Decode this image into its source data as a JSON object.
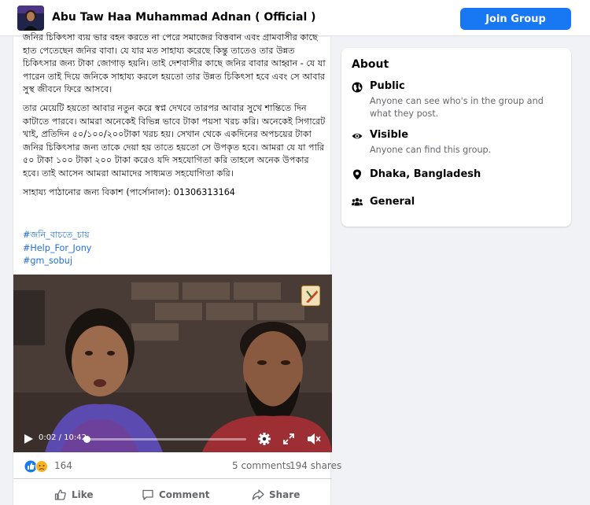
{
  "header": {
    "group_name": "Abu Taw Haa Muhammad Adnan ( Official )",
    "join_label": "Join Group"
  },
  "post": {
    "paragraph1": "জনির চিকিৎসা ব্যয় ভার বহন করতে না পেরে সমাজের বিত্তবান এবং গ্রামবাসীর কাছে হাত পেতেছেন জনির বাবা। যে যার মত সাহায্য করেছে কিন্তু তাতেও তার উন্নত চিকিৎসার জন্য টাকা জোগাড় হয়নি। তাই দেশবাসীর কাছে জনির বাবার আহ্বান - যে যা পারেন তাই দিয়ে জনিকে সাহায্য করলে হয়তো তার উন্নত চিকিৎসা হবে এবং সে আবার সুস্থ জীবনে ফিরে আসবে।",
    "paragraph2": "তার মেয়েটি হয়তো আবার নতুন করে স্বপ্ন দেখবে তারপর আবার সুখে শান্তিতে দিন কাটাতে পারবে। আমরা অনেকেই বিভিন্ন ভাবে টাকা পয়সা খরচ করি। অনেকেই সিগারেট খাই, প্রতিদিন ৫০/১০০/২০০টাকা খরচ হয়। সেখান থেকে একদিনের অপচয়ের টাকা জনির চিকিৎসার জন্য তাকে দেয়া হয় তাতে হয়তো সে উপকৃত হবে। আমরা যে যা পারি ৫০ টাকা ১০০ টাকা ২০০ টাকা করেও যদি সহযোগিতা করি তাহলে অনেক উপকার হবে। তাই আসেন আমরা আমাদের সাধ্যমত সহযোগিতা করি।",
    "contact": "সাহায্য পাঠানোর জন্য বিকাশ (পার্সোনাল): 01306313164",
    "hashtags": [
      "#জনি_বাচতে_চায়",
      "#Help_For_Jony",
      "#gm_sobuj"
    ],
    "video": {
      "time": "0:02 / 10:42",
      "progress": 0.003
    },
    "reactions": {
      "icons": [
        "like-icon",
        "sad-icon"
      ],
      "count": "164"
    },
    "comments": "5 comments",
    "shares": "194 shares",
    "actions": {
      "like": "Like",
      "comment": "Comment",
      "share": "Share"
    }
  },
  "about": {
    "title": "About",
    "items": [
      {
        "icon": "globe-icon",
        "heading": "Public",
        "desc": "Anyone can see who's in the group and what they post."
      },
      {
        "icon": "eye-icon",
        "heading": "Visible",
        "desc": "Anyone can find this group."
      },
      {
        "icon": "location-pin-icon",
        "heading": "Dhaka, Bangladesh",
        "desc": ""
      },
      {
        "icon": "people-icon",
        "heading": "General",
        "desc": ""
      }
    ]
  },
  "colors": {
    "accent": "#1877f2",
    "link": "#216fdb",
    "secondary_text": "#65676b",
    "background": "#f0f2f5"
  }
}
